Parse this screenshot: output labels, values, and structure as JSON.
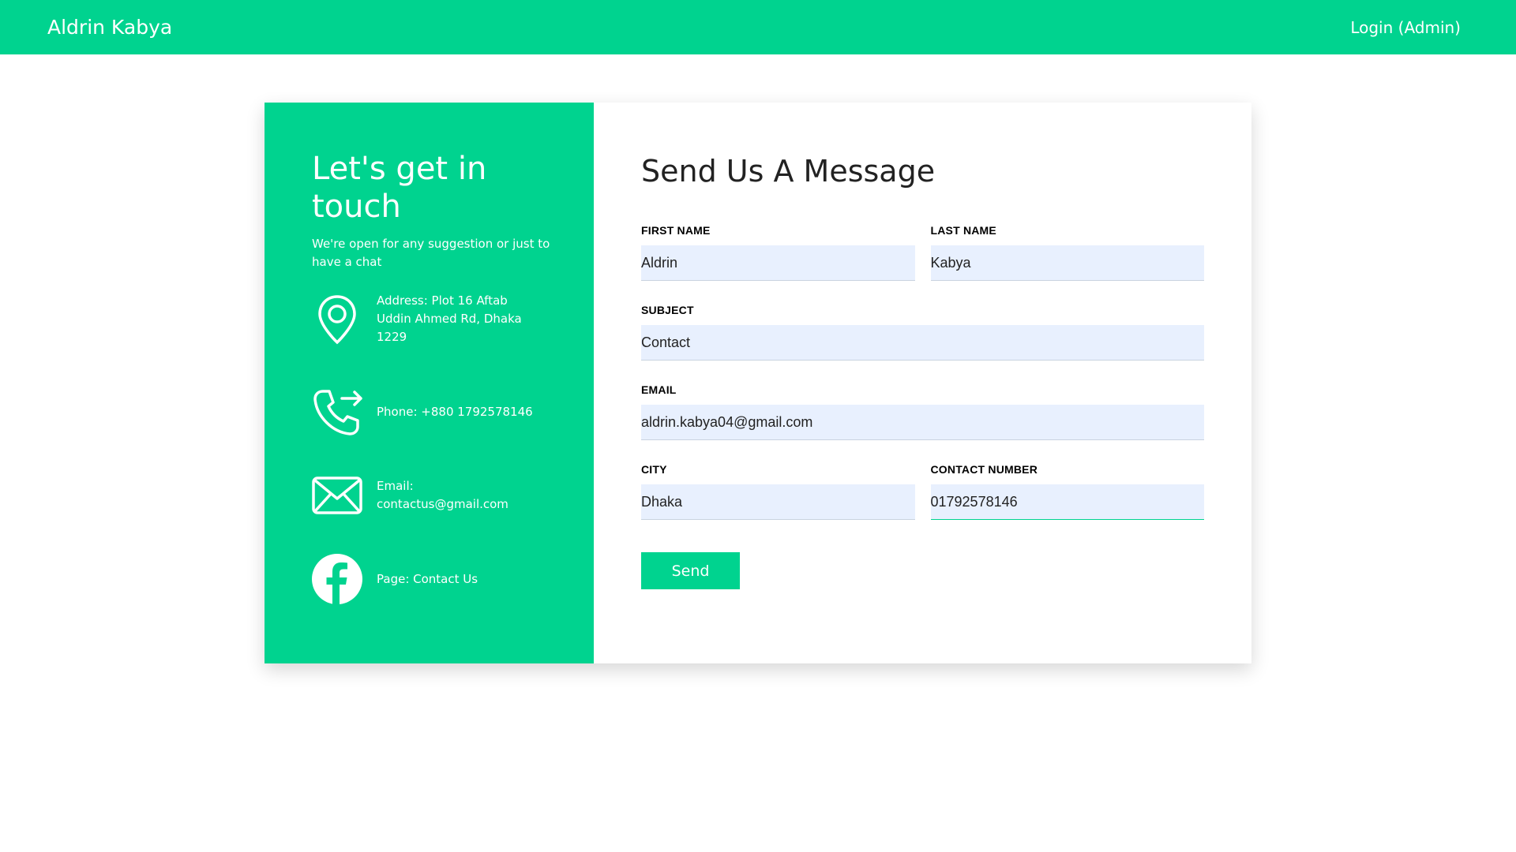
{
  "navbar": {
    "brand": "Aldrin Kabya",
    "login": "Login (Admin)"
  },
  "info": {
    "title": "Let's get in touch",
    "subtitle": "We're open for any suggestion or just to have a chat",
    "address": "Address: Plot 16 Aftab Uddin Ahmed Rd, Dhaka 1229",
    "phone": "Phone: +880 1792578146",
    "email": "Email: contactus@gmail.com",
    "page": "Page: Contact Us"
  },
  "form": {
    "title": "Send Us A Message",
    "first_name": {
      "label": "FIRST NAME",
      "value": "Aldrin"
    },
    "last_name": {
      "label": "LAST NAME",
      "value": "Kabya"
    },
    "subject": {
      "label": "SUBJECT",
      "value": "Contact"
    },
    "email": {
      "label": "EMAIL",
      "value": "aldrin.kabya04@gmail.com"
    },
    "city": {
      "label": "CITY",
      "value": "Dhaka"
    },
    "contact_number": {
      "label": "CONTACT NUMBER",
      "value": "01792578146"
    },
    "send_label": "Send"
  },
  "colors": {
    "accent": "#00d38f",
    "input_bg": "#e8f0fe"
  },
  "icons": [
    "location-pin-icon",
    "phone-icon",
    "email-icon",
    "facebook-icon"
  ]
}
